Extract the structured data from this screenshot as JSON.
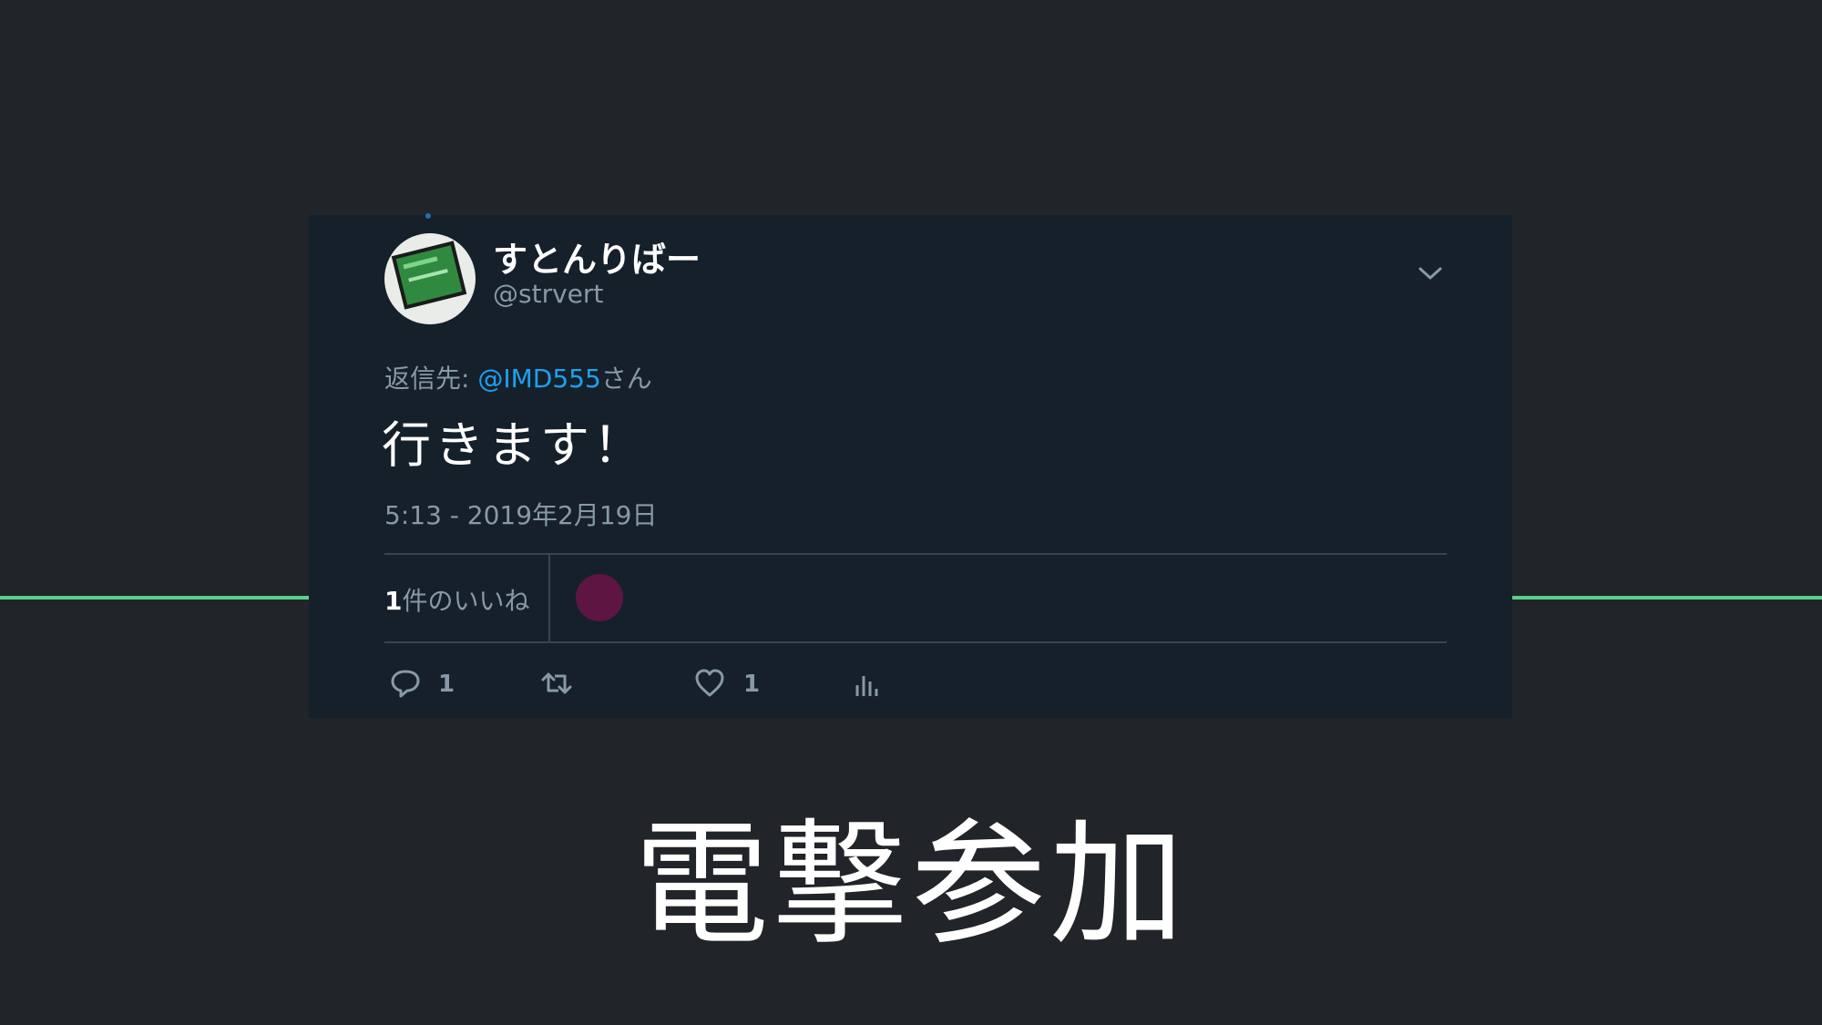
{
  "tweet": {
    "display_name": "すとんりばー",
    "handle": "@strvert",
    "reply_prefix": "返信先: ",
    "reply_mention": "@IMD555",
    "reply_suffix": "さん",
    "text": "行きます！",
    "timestamp": "5:13 - 2019年2月19日",
    "likes_count": "1",
    "likes_label": "件のいいね",
    "reply_count": "1",
    "retweet_count": "",
    "like_count": "1"
  },
  "caption": "電撃参加",
  "colors": {
    "background": "#212529",
    "card": "#15202b",
    "accent_line": "#5bd08a",
    "mention": "#1da1f2",
    "muted_text": "#8899a6"
  },
  "icons": [
    "chevron-down-icon",
    "reply-icon",
    "retweet-icon",
    "heart-icon",
    "analytics-icon"
  ]
}
